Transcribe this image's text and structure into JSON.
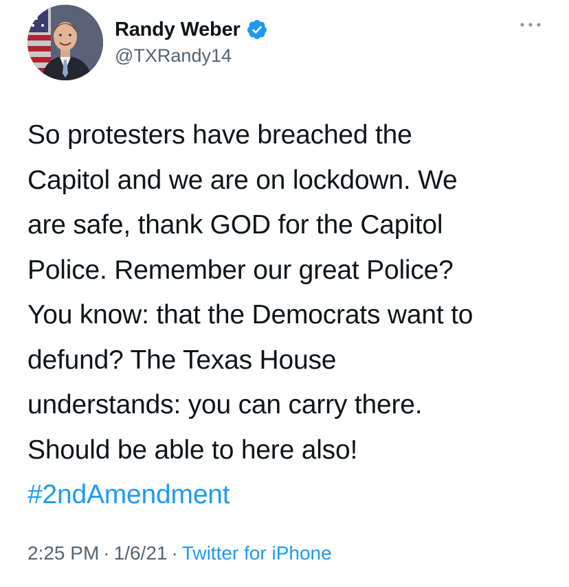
{
  "user": {
    "display_name": "Randy Weber",
    "handle": "@TXRandy14",
    "verified": true
  },
  "tweet": {
    "text_lines": [
      "So protesters have breached the",
      "Capitol and we are on lockdown. We",
      "are safe, thank GOD for the Capitol",
      "Police. Remember our great Police?",
      "You know: that the Democrats want to",
      "defund? The Texas House",
      "understands: you can carry there.",
      "Should be able to here also!"
    ],
    "hashtag": "#2ndAmendment",
    "time": "2:25 PM",
    "separator": "·",
    "date": "1/6/21",
    "source": "Twitter for iPhone"
  },
  "icons": {
    "verified": "verified-badge-icon",
    "more": "more-options-icon"
  },
  "colors": {
    "text": "#0f1419",
    "secondary": "#536471",
    "link": "#1d9bf0",
    "verified": "#1d9bf0"
  }
}
